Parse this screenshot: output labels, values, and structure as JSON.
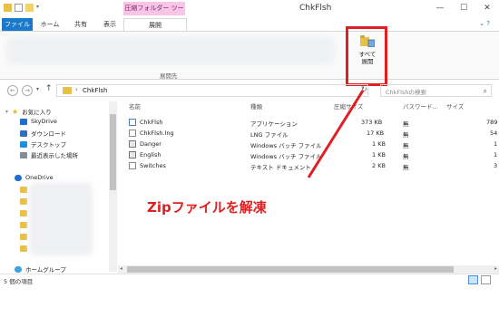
{
  "window": {
    "title": "ChkFlsh",
    "context_tab_title": "圧縮フォルダー ツール",
    "controls": [
      "—",
      "☐",
      "✕"
    ]
  },
  "ribbon": {
    "tabs": {
      "file": "ファイル",
      "home": "ホーム",
      "share": "共有",
      "view": "表示",
      "extract": "展開"
    },
    "group_label": "展開先",
    "extract_all_label": "すべて\n展開"
  },
  "address": {
    "path": "ChkFlsh",
    "search_placeholder": "ChkFlshの検索"
  },
  "nav": {
    "items": {
      "favorites": "お気に入り",
      "skydrive": "SkyDrive",
      "downloads": "ダウンロード",
      "desktop": "デスクトップ",
      "recent": "最近表示した場所",
      "onedrive": "OneDrive",
      "homegroup": "ホームグループ"
    }
  },
  "columns": {
    "name": "名前",
    "type": "種類",
    "compressed": "圧縮サイズ",
    "password": "パスワード...",
    "size": "サイズ"
  },
  "files": [
    {
      "name": "ChkFlsh",
      "type": "アプリケーション",
      "compressed": "373 KB",
      "password": "無",
      "size": "789"
    },
    {
      "name": "ChkFlsh.lng",
      "type": "LNG ファイル",
      "compressed": "17 KB",
      "password": "無",
      "size": "54"
    },
    {
      "name": "Danger",
      "type": "Windows バッチ ファイル",
      "compressed": "1 KB",
      "password": "無",
      "size": "1"
    },
    {
      "name": "English",
      "type": "Windows バッチ ファイル",
      "compressed": "1 KB",
      "password": "無",
      "size": "1"
    },
    {
      "name": "Switches",
      "type": "テキスト ドキュメント",
      "compressed": "2 KB",
      "password": "無",
      "size": "3"
    }
  ],
  "annotation": "Zipファイルを解凍",
  "status": {
    "item_count": "5 個の項目"
  },
  "colors": {
    "accent": "#1979ca",
    "highlight": "#e02020",
    "context_tab": "#f7c6e7"
  }
}
